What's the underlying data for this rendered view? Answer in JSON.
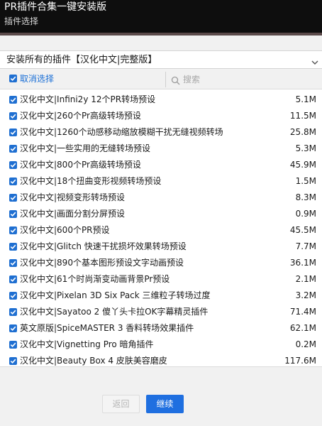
{
  "window": {
    "title": "PR插件合集一键安装版",
    "subtitle": "插件选择"
  },
  "preset": {
    "selected": "安装所有的插件【汉化中文|完整版】"
  },
  "toolbar": {
    "deselect_label": "取消选择",
    "search_placeholder": "搜索"
  },
  "items": [
    {
      "name": "汉化中文|Infini2y 12个PR转场预设",
      "size": "5.1M",
      "checked": true
    },
    {
      "name": "汉化中文|260个Pr高级转场预设",
      "size": "11.5M",
      "checked": true
    },
    {
      "name": "汉化中文|1260个动感移动缩放模糊干扰无缝视频转场",
      "size": "25.8M",
      "checked": true
    },
    {
      "name": "汉化中文|一些实用的无缝转场预设",
      "size": "5.3M",
      "checked": true
    },
    {
      "name": "汉化中文|800个Pr高级转场预设",
      "size": "45.9M",
      "checked": true
    },
    {
      "name": "汉化中文|18个扭曲变形视频转场预设",
      "size": "1.5M",
      "checked": true
    },
    {
      "name": "汉化中文|视频变形转场预设",
      "size": "8.3M",
      "checked": true
    },
    {
      "name": "汉化中文|画面分割分屏预设",
      "size": "0.9M",
      "checked": true
    },
    {
      "name": "汉化中文|600个PR预设",
      "size": "45.5M",
      "checked": true
    },
    {
      "name": "汉化中文|Glitch 快速干扰损坏效果转场预设",
      "size": "7.7M",
      "checked": true
    },
    {
      "name": "汉化中文|890个基本图形预设文字动画预设",
      "size": "36.1M",
      "checked": true
    },
    {
      "name": "汉化中文|61个时尚渐变动画背景Pr预设",
      "size": "2.1M",
      "checked": true
    },
    {
      "name": "汉化中文|Pixelan 3D Six Pack 三维粒子转场过度",
      "size": "3.2M",
      "checked": true
    },
    {
      "name": "汉化中文|Sayatoo 2 傻丫头卡拉OK字幕精灵插件",
      "size": "71.4M",
      "checked": true
    },
    {
      "name": "英文原版|SpiceMASTER 3 香料转场效果插件",
      "size": "62.1M",
      "checked": true
    },
    {
      "name": "汉化中文|Vignetting Pro 暗角插件",
      "size": "0.2M",
      "checked": true
    },
    {
      "name": "汉化中文|Beauty Box 4 皮肤美容磨皮",
      "size": "117.6M",
      "checked": true
    }
  ],
  "buttons": {
    "back_label": "返回",
    "next_label": "继续"
  },
  "colors": {
    "accent": "#1f6fe0",
    "titlebar": "#0e0e0e",
    "link": "#1a6fd6"
  }
}
